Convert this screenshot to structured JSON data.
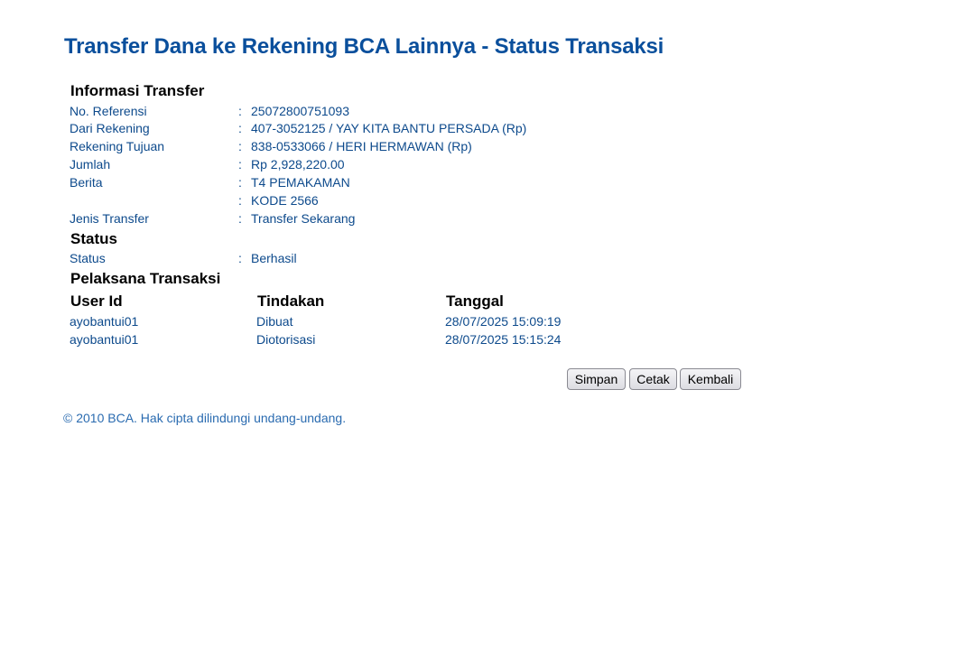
{
  "page_title": "Transfer Dana ke Rekening BCA Lainnya - Status Transaksi",
  "transfer_info": {
    "heading": "Informasi Transfer",
    "rows": [
      {
        "label": "No. Referensi",
        "value": "25072800751093"
      },
      {
        "label": "Dari Rekening",
        "value": "407-3052125 / YAY KITA BANTU PERSADA  (Rp)"
      },
      {
        "label": "Rekening Tujuan",
        "value": "838-0533066 / HERI HERMAWAN  (Rp)"
      },
      {
        "label": "Jumlah",
        "value": "Rp  2,928,220.00"
      },
      {
        "label": "Berita",
        "value": "T4 PEMAKAMAN"
      },
      {
        "label": "",
        "value": "KODE 2566"
      },
      {
        "label": "Jenis Transfer",
        "value": "Transfer Sekarang"
      }
    ]
  },
  "status": {
    "heading": "Status",
    "label": "Status",
    "value": "Berhasil"
  },
  "executors": {
    "heading": "Pelaksana Transaksi",
    "columns": [
      "User Id",
      "Tindakan",
      "Tanggal"
    ],
    "rows": [
      {
        "user_id": "ayobantui01",
        "action": "Dibuat",
        "date": "28/07/2025 15:09:19"
      },
      {
        "user_id": "ayobantui01",
        "action": "Diotorisasi",
        "date": "28/07/2025 15:15:24"
      }
    ]
  },
  "separator": ":",
  "buttons": {
    "save": "Simpan",
    "print": "Cetak",
    "back": "Kembali"
  },
  "footer": "©  2010 BCA. Hak cipta dilindungi undang-undang.",
  "colors": {
    "title": "#0a4f9c",
    "text": "#0d4a8c",
    "footer": "#2a6bb0"
  }
}
